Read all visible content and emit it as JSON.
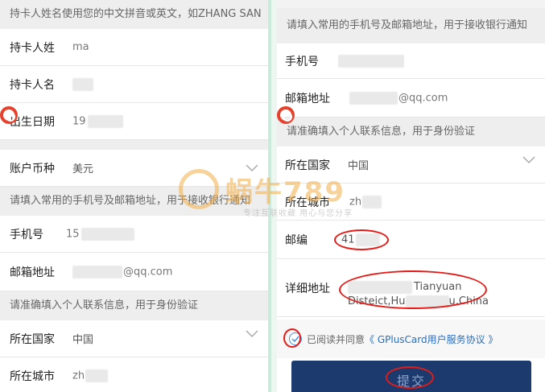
{
  "left": {
    "hint_name": "持卡人姓名使用您的中文拼音或英文，如ZHANG SAN",
    "rows": {
      "surname": {
        "label": "持卡人姓",
        "value": "ma"
      },
      "given_name": {
        "label": "持卡人名",
        "value": ""
      },
      "birthdate": {
        "label": "出生日期",
        "value": "19"
      },
      "currency": {
        "label": "账户币种",
        "value": "美元"
      },
      "phone": {
        "label": "手机号",
        "value": "15"
      },
      "email": {
        "label": "邮箱地址",
        "value": "@qq.com"
      },
      "country": {
        "label": "所在国家",
        "value": "中国"
      },
      "city": {
        "label": "所在城市",
        "value": "zh"
      }
    },
    "hint_contact": "请填入常用的手机号及邮箱地址，用于接收银行通知",
    "hint_identity": "请准确填入个人联系信息，用于身份验证"
  },
  "right": {
    "hint_contact": "请填入常用的手机号及邮箱地址，用于接收银行通知",
    "rows": {
      "phone": {
        "label": "手机号",
        "value": ""
      },
      "email": {
        "label": "邮箱地址",
        "value": "@qq.com"
      },
      "country": {
        "label": "所在国家",
        "value": "中国"
      },
      "city": {
        "label": "所在城市",
        "value": "zh"
      },
      "postcode": {
        "label": "邮编",
        "value": "41"
      },
      "address": {
        "label": "详细地址",
        "value_line1": "Tianyuan",
        "value_line2": "Disteict,Hu",
        "value_line2_end": "u,China"
      }
    },
    "hint_identity": "请准确填入个人联系信息，用于身份验证",
    "agree_prefix": "已阅读并同意",
    "agree_link": "《 GPlusCard用户服务协议 》",
    "submit_label": "提交"
  },
  "watermark": {
    "brand": "蜗牛789",
    "sub": "专注互联收藏  用心与您分享"
  },
  "colors": {
    "accent_red": "#e41b17",
    "submit_bg": "#1c3a6e",
    "link": "#2a6ebd",
    "separator": "#c9eadc"
  }
}
